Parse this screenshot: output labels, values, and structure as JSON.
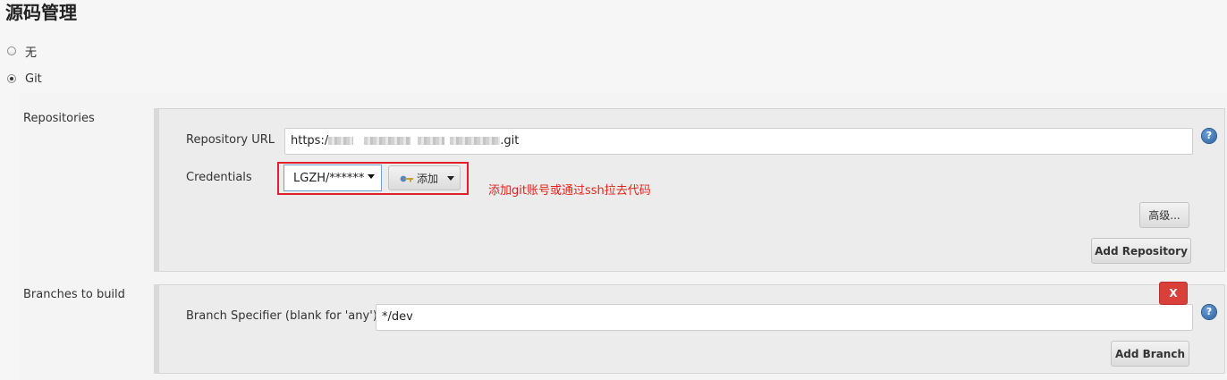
{
  "section": {
    "title": "源码管理"
  },
  "scm_options": [
    {
      "label": "无",
      "checked": false
    },
    {
      "label": "Git",
      "checked": true
    }
  ],
  "repositories": {
    "label": "Repositories",
    "url_label": "Repository URL",
    "url_value_prefix": "https:/",
    "url_value_suffix": ".git",
    "credentials_label": "Credentials",
    "credentials_selected": "LGZH/******",
    "add_button_label": "添加",
    "annotation": "添加git账号或通过ssh拉去代码",
    "advanced_button": "高级...",
    "add_repository_button": "Add Repository",
    "help_icon": "?"
  },
  "branches": {
    "label": "Branches to build",
    "specifier_label": "Branch Specifier (blank for 'any')",
    "specifier_value": "*/dev",
    "delete_button": "X",
    "add_branch_button": "Add Branch",
    "help_icon": "?"
  },
  "colors": {
    "accent_red": "#e2231a",
    "delete_red": "#d9403a",
    "help_blue": "#2a5f9e"
  }
}
